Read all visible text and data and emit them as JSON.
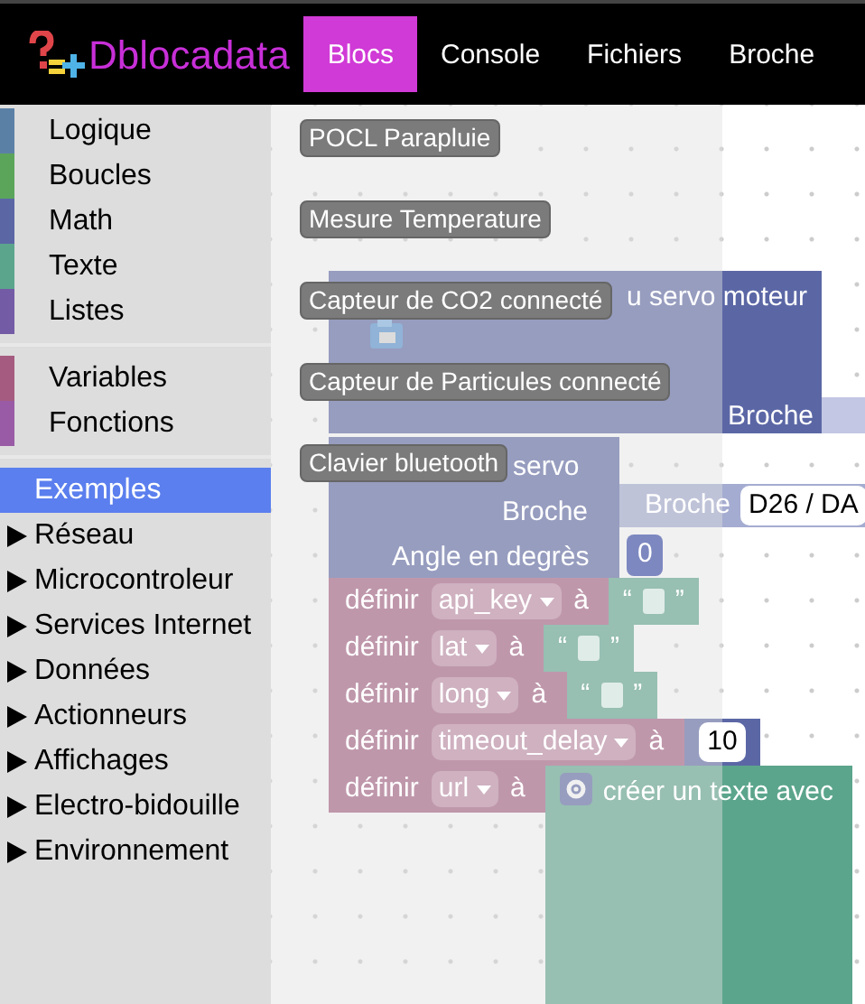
{
  "navbar": {
    "brand": "Dblocadata",
    "tabs": [
      {
        "label": "Blocs",
        "selected": true
      },
      {
        "label": "Console",
        "selected": false
      },
      {
        "label": "Fichiers",
        "selected": false
      },
      {
        "label": "Broche",
        "selected": false
      }
    ]
  },
  "toolbox": {
    "groups": [
      [
        {
          "label": "Logique",
          "color": "#5b80a5",
          "selected": false
        },
        {
          "label": "Boucles",
          "color": "#5ba55b",
          "selected": false
        },
        {
          "label": "Math",
          "color": "#5b67a5",
          "selected": false
        },
        {
          "label": "Texte",
          "color": "#5ba58c",
          "selected": false
        },
        {
          "label": "Listes",
          "color": "#745ba5",
          "selected": false
        }
      ],
      [
        {
          "label": "Variables",
          "color": "#a55b80",
          "selected": false
        },
        {
          "label": "Fonctions",
          "color": "#995ba5",
          "selected": false
        }
      ],
      [
        {
          "label": "Exemples",
          "selected": true,
          "expandable": false
        },
        {
          "label": "Réseau",
          "selected": false,
          "expandable": true
        },
        {
          "label": "Microcontroleur",
          "selected": false,
          "expandable": true
        },
        {
          "label": "Services Internet",
          "selected": false,
          "expandable": true
        },
        {
          "label": "Données",
          "selected": false,
          "expandable": true
        },
        {
          "label": "Actionneurs",
          "selected": false,
          "expandable": true
        },
        {
          "label": "Affichages",
          "selected": false,
          "expandable": true
        },
        {
          "label": "Electro-bidouille",
          "selected": false,
          "expandable": true
        },
        {
          "label": "Environnement",
          "selected": false,
          "expandable": true
        }
      ]
    ]
  },
  "flyout": {
    "buttons": [
      "POCL Parapluie",
      "Mesure Temperature",
      "Capteur de CO2 connecté",
      "Capteur de Particules connecté",
      "Clavier bluetooth"
    ]
  },
  "workspace": {
    "blocks": [
      {
        "kind": "servo",
        "title": "u servo moteur",
        "pin_label": "Broche"
      },
      {
        "kind": "servo_set",
        "title": "servo",
        "pin_label": "Broche",
        "angle_label": "Angle en degrès",
        "angle": "0",
        "pin_block": {
          "label": "Broche",
          "value": "D26 / DA"
        }
      },
      {
        "kind": "set",
        "label": "définir",
        "variable": "api_key",
        "to": "à",
        "value": {
          "kind": "text",
          "open": "“",
          "close": "”"
        }
      },
      {
        "kind": "set",
        "label": "définir",
        "variable": "lat",
        "to": "à",
        "value": {
          "kind": "text",
          "open": "“",
          "close": "”"
        }
      },
      {
        "kind": "set",
        "label": "définir",
        "variable": "long",
        "to": "à",
        "value": {
          "kind": "text",
          "open": "“",
          "close": "”"
        }
      },
      {
        "kind": "set",
        "label": "définir",
        "variable": "timeout_delay",
        "to": "à",
        "value": {
          "kind": "number",
          "text": "10"
        }
      },
      {
        "kind": "set",
        "label": "définir",
        "variable": "url",
        "to": "à",
        "value": {
          "kind": "join",
          "text": "créer un texte avec"
        }
      }
    ]
  }
}
